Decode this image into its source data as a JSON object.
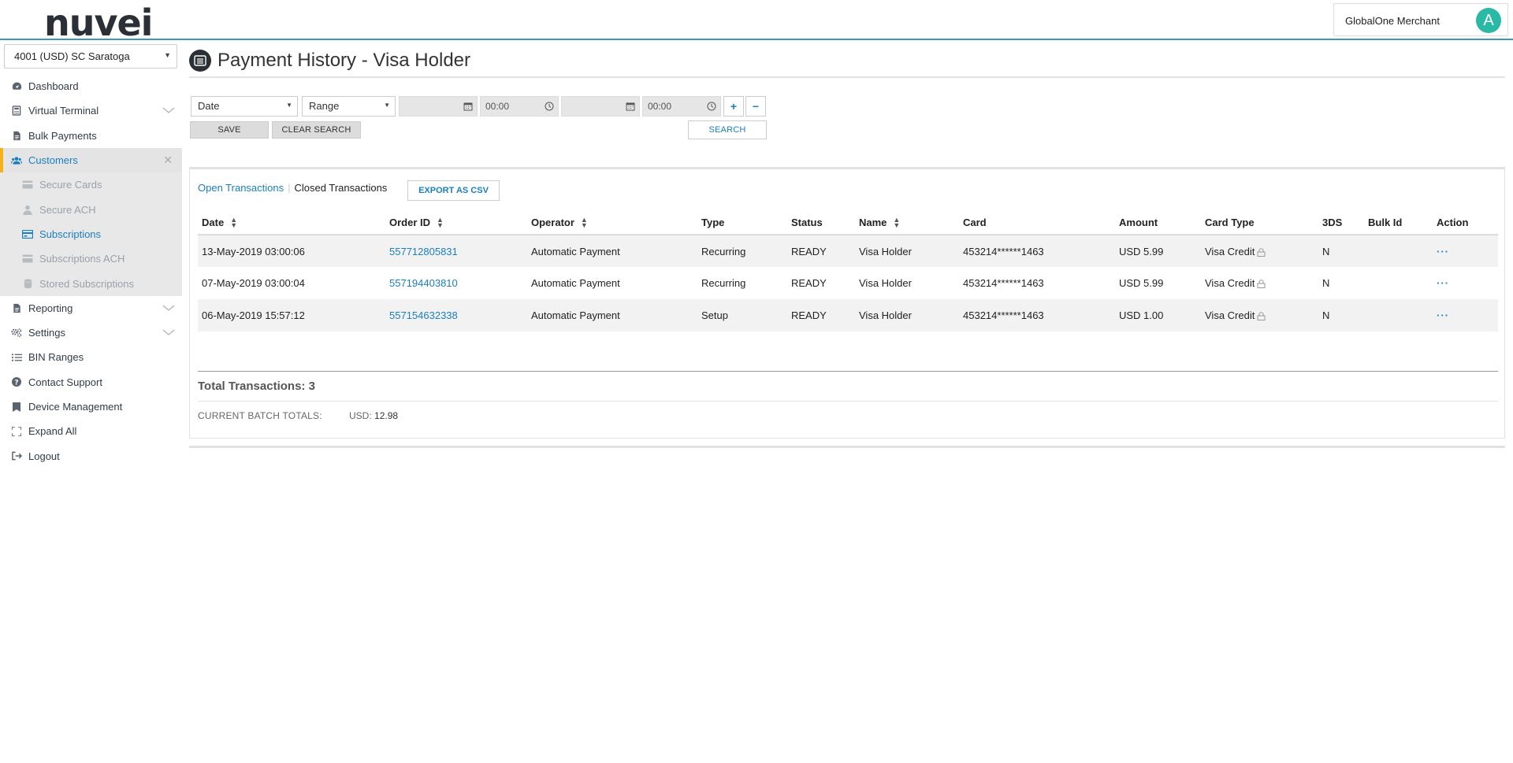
{
  "header": {
    "logo_text": "nuvei",
    "merchant_name": "GlobalOne Merchant",
    "avatar_letter": "A"
  },
  "sidebar": {
    "account": "4001 (USD) SC Saratoga",
    "items": [
      {
        "label": "Dashboard",
        "icon": "dashboard-icon"
      },
      {
        "label": "Virtual Terminal",
        "icon": "calculator-icon"
      },
      {
        "label": "Bulk Payments",
        "icon": "file-icon"
      },
      {
        "label": "Customers",
        "icon": "users-icon"
      },
      {
        "label": "Reporting",
        "icon": "file-icon"
      },
      {
        "label": "Settings",
        "icon": "gears-icon"
      },
      {
        "label": "BIN Ranges",
        "icon": "list-icon"
      },
      {
        "label": "Contact Support",
        "icon": "question-icon"
      },
      {
        "label": "Device Management",
        "icon": "bookmark-icon"
      },
      {
        "label": "Expand All",
        "icon": "expand-icon"
      },
      {
        "label": "Logout",
        "icon": "logout-icon"
      }
    ],
    "customers_sub": [
      {
        "label": "Secure Cards"
      },
      {
        "label": "Secure ACH"
      },
      {
        "label": "Subscriptions"
      },
      {
        "label": "Subscriptions ACH"
      },
      {
        "label": "Stored Subscriptions"
      }
    ]
  },
  "main": {
    "title": "Payment History - Visa Holder",
    "filter": {
      "field": "Date",
      "mode": "Range",
      "from_time": "00:00",
      "to_time": "00:00",
      "save": "SAVE",
      "clear": "CLEAR SEARCH",
      "search": "SEARCH",
      "add": "+",
      "remove": "−"
    },
    "tabs": {
      "open": "Open Transactions",
      "sep": "|",
      "closed": "Closed Transactions",
      "export": "EXPORT AS CSV"
    },
    "columns": [
      "Date",
      "Order ID",
      "Operator",
      "Type",
      "Status",
      "Name",
      "Card",
      "Amount",
      "Card Type",
      "3DS",
      "Bulk Id",
      "Action"
    ],
    "rows": [
      {
        "date": "13-May-2019 03:00:06",
        "order_id": "557712805831",
        "operator": "Automatic Payment",
        "type": "Recurring",
        "status": "READY",
        "name": "Visa Holder",
        "card": "453214******1463",
        "amount": "USD 5.99",
        "card_type": "Visa Credit",
        "tds": "N",
        "bulk_id": "",
        "action": "···"
      },
      {
        "date": "07-May-2019 03:00:04",
        "order_id": "557194403810",
        "operator": "Automatic Payment",
        "type": "Recurring",
        "status": "READY",
        "name": "Visa Holder",
        "card": "453214******1463",
        "amount": "USD 5.99",
        "card_type": "Visa Credit",
        "tds": "N",
        "bulk_id": "",
        "action": "···"
      },
      {
        "date": "06-May-2019 15:57:12",
        "order_id": "557154632338",
        "operator": "Automatic Payment",
        "type": "Setup",
        "status": "READY",
        "name": "Visa Holder",
        "card": "453214******1463",
        "amount": "USD 1.00",
        "card_type": "Visa Credit",
        "tds": "N",
        "bulk_id": "",
        "action": "···"
      }
    ],
    "summary": {
      "total": "Total Transactions: 3",
      "batch_label": "CURRENT BATCH TOTALS:",
      "batch_currency": "USD:",
      "batch_amount": "12.98"
    }
  },
  "colors": {
    "accent": "#1a7fbf",
    "brand_teal": "#2ab9a5",
    "active_marker": "#f3b21a",
    "header_rule": "#3a9bb5"
  }
}
